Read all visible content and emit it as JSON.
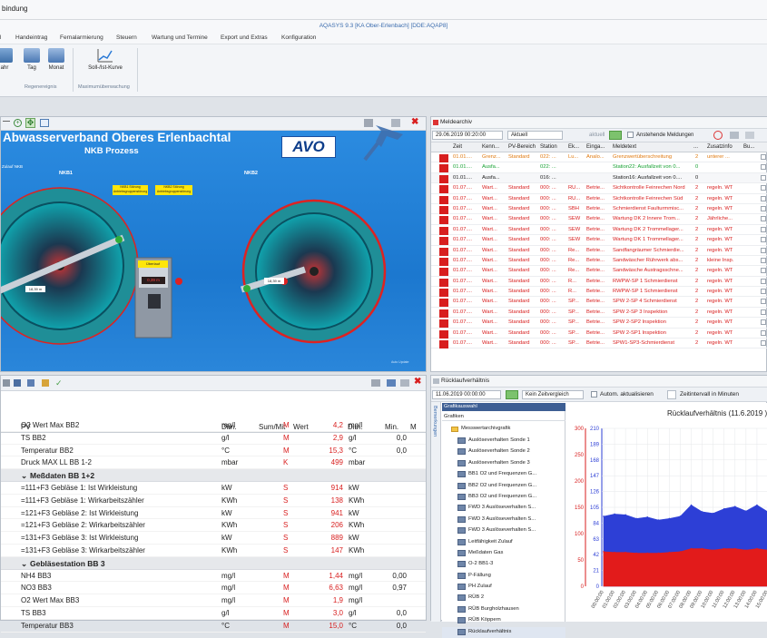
{
  "window_title": "bindung",
  "app_subtitle": "AQASYS 9.3 [KA Ober-Erlenbach] [DDE:AQAP8]",
  "menu": [
    "l",
    "Handeintrag",
    "Fernalarmierung",
    "Steuern",
    "Wartung und Termine",
    "Export und Extras",
    "Konfiguration"
  ],
  "ribbon": {
    "buttons": [
      "ahr",
      "Tag",
      "Monat",
      "Soll-/Ist-Kurve"
    ],
    "groups": [
      "Regenereignis",
      "Maximumüberwachung"
    ]
  },
  "process": {
    "title": "Abwasserverband Oberes Erlenbachtal",
    "subtitle": "NKB Prozess",
    "logo": "AVO",
    "left_label": "NKB1",
    "right_label": "NKB2",
    "left_small_label": "Zulauf NKB",
    "box_warn_1": "NKB1 Störung Antriebsgruppenstörung",
    "box_warn_2": "NKB2 Störung Antriebsgruppenstörung",
    "center_box_label": "Überlauf",
    "center_value": "0,39 m",
    "left_meter": "18,39 m",
    "right_meter": "18,39 m",
    "footer_note": "Auto Update"
  },
  "meldearchiv": {
    "title": "Meldearchiv",
    "datetime": "29.06.2019 00:20:00",
    "mode": "Aktuell",
    "aktuell": "aktuell",
    "pending_label": "Anstehende Meldungen",
    "columns": [
      "Zeit",
      "Kenn...",
      "PV-Bereich",
      "Station",
      "Ek...",
      "Einga...",
      "Meldetext",
      "...",
      "Zusatzinfo",
      "Bu..."
    ],
    "rows": [
      [
        "01.01....",
        "Grenz...",
        "Standard",
        "022: ...",
        "Lu...",
        "Analo...",
        "Grenzwertüberschreitung",
        "2",
        "unterer ...",
        "orange"
      ],
      [
        "01.01....",
        "Ausfa...",
        "",
        "022: ...",
        "",
        "",
        "Station22: Ausfallzeit von 0...",
        "0",
        "",
        "green"
      ],
      [
        "01.01....",
        "Ausfa...",
        "",
        "016: ...",
        "",
        "",
        "Station16: Ausfallzeit von 0....",
        "0",
        "",
        "black"
      ],
      [
        "01.07....",
        "Wart...",
        "Standard",
        "000: ...",
        "RU...",
        "Betrie...",
        "Sichtkontrolle Feinrechen Nord",
        "2",
        "regeln. WT",
        "red"
      ],
      [
        "01.07....",
        "Wart...",
        "Standard",
        "000: ...",
        "RU...",
        "Betrie...",
        "Sichtkontrolle Feinrechen Süd",
        "2",
        "regeln. WT",
        "red"
      ],
      [
        "01.07....",
        "Wart...",
        "Standard",
        "000: ...",
        "SBH",
        "Betrie...",
        "Schmierdienst Faulturmmisc...",
        "2",
        "regeln. WT",
        "red"
      ],
      [
        "01.07....",
        "Wart...",
        "Standard",
        "000: ...",
        "SEW",
        "Betrie...",
        "Wartung DK 2 Innere Trom...",
        "2",
        "Jährliche...",
        "red"
      ],
      [
        "01.07....",
        "Wart...",
        "Standard",
        "000: ...",
        "SEW",
        "Betrie...",
        "Wartung DK 2 Trommellager...",
        "2",
        "regeln. WT",
        "red"
      ],
      [
        "01.07....",
        "Wart...",
        "Standard",
        "000: ...",
        "SEW",
        "Betrie...",
        "Wartung DK 1 Trommellager...",
        "2",
        "regeln. WT",
        "red"
      ],
      [
        "01.07....",
        "Wart...",
        "Standard",
        "000: ...",
        "Re...",
        "Betrie...",
        "Sandfangräumer Schmierdie...",
        "2",
        "regeln. WT",
        "red"
      ],
      [
        "01.07....",
        "Wart...",
        "Standard",
        "000: ...",
        "Re...",
        "Betrie...",
        "Sandwäscher Rührwerk abs...",
        "2",
        "kleine Insp.",
        "red"
      ],
      [
        "01.07....",
        "Wart...",
        "Standard",
        "000: ...",
        "Re...",
        "Betrie...",
        "Sandwäsche Austragsschne...",
        "2",
        "regeln. WT",
        "red"
      ],
      [
        "01.07....",
        "Wart...",
        "Standard",
        "000: ...",
        "R...",
        "Betrie...",
        "RWPW-SP 1 Schmierdienst",
        "2",
        "regeln. WT",
        "red"
      ],
      [
        "01.07....",
        "Wart...",
        "Standard",
        "000: ...",
        "R...",
        "Betrie...",
        "RWPW-SP 1 Schmierdienst",
        "2",
        "regeln. WT",
        "red"
      ],
      [
        "01.07....",
        "Wart...",
        "Standard",
        "000: ...",
        "SP...",
        "Betrie...",
        "SPW 2-SP 4 Schmierdienst",
        "2",
        "regeln. WT",
        "red"
      ],
      [
        "01.07....",
        "Wart...",
        "Standard",
        "000: ...",
        "SP...",
        "Betrie...",
        "SPW 2-SP 3 Inspektion",
        "2",
        "regeln. WT",
        "red"
      ],
      [
        "01.07....",
        "Wart...",
        "Standard",
        "000: ...",
        "SP...",
        "Betrie...",
        "SPW 2-SP2 Inspektion",
        "2",
        "regeln. WT",
        "red"
      ],
      [
        "01.07....",
        "Wart...",
        "Standard",
        "000: ...",
        "SP...",
        "Betrie...",
        "SPW 2-SP1 Inspektion",
        "2",
        "regeln. WT",
        "red"
      ],
      [
        "01.07....",
        "Wart...",
        "Standard",
        "000: ...",
        "SP...",
        "Betrie...",
        "SPW1-SP3-Schmierdienst",
        "2",
        "regeln. WT",
        "red"
      ]
    ]
  },
  "pvtable": {
    "columns": [
      "PV",
      "Dim.",
      "Sum/Mit",
      "Wert",
      "Dim.",
      "Min.",
      "M"
    ],
    "rows": [
      {
        "t": "r",
        "pv": "O2 Wert Max BB2",
        "dim": "mg/l",
        "sum": "M",
        "wert": "4,2",
        "dim2": "mg/l",
        "min": ""
      },
      {
        "t": "r",
        "pv": "TS BB2",
        "dim": "g/l",
        "sum": "M",
        "wert": "2,9",
        "dim2": "g/l",
        "min": "0,0"
      },
      {
        "t": "r",
        "pv": "Temperatur BB2",
        "dim": "°C",
        "sum": "M",
        "wert": "15,3",
        "dim2": "°C",
        "min": "0,0"
      },
      {
        "t": "r",
        "pv": "Druck MAX LL BB 1-2",
        "dim": "mbar",
        "sum": "K",
        "wert": "499",
        "dim2": "mbar",
        "min": ""
      },
      {
        "t": "g",
        "pv": "Meßdaten BB 1+2"
      },
      {
        "t": "r",
        "pv": "=111+F3 Gebläse 1: Ist Wirkleistung",
        "dim": "kW",
        "sum": "S",
        "wert": "914",
        "dim2": "kW",
        "min": ""
      },
      {
        "t": "r",
        "pv": "=111+F3 Gebläse 1: Wirkarbeitszähler",
        "dim": "KWh",
        "sum": "S",
        "wert": "138",
        "dim2": "KWh",
        "min": ""
      },
      {
        "t": "r",
        "pv": "=121+F3 Gebläse 2: Ist Wirkleistung",
        "dim": "kW",
        "sum": "S",
        "wert": "941",
        "dim2": "kW",
        "min": ""
      },
      {
        "t": "r",
        "pv": "=121+F3 Gebläse 2: Wirkarbeitszähler",
        "dim": "KWh",
        "sum": "S",
        "wert": "206",
        "dim2": "KWh",
        "min": ""
      },
      {
        "t": "r",
        "pv": "=131+F3 Gebläse 3: Ist Wirkleistung",
        "dim": "kW",
        "sum": "S",
        "wert": "889",
        "dim2": "kW",
        "min": ""
      },
      {
        "t": "r",
        "pv": "=131+F3 Gebläse 3: Wirkarbeitszähler",
        "dim": "KWh",
        "sum": "S",
        "wert": "147",
        "dim2": "KWh",
        "min": ""
      },
      {
        "t": "g",
        "pv": "Gebläsestation BB 3"
      },
      {
        "t": "r",
        "pv": "NH4 BB3",
        "dim": "mg/l",
        "sum": "M",
        "wert": "1,44",
        "dim2": "mg/l",
        "min": "0,00"
      },
      {
        "t": "r",
        "pv": "NO3 BB3",
        "dim": "mg/l",
        "sum": "M",
        "wert": "6,63",
        "dim2": "mg/l",
        "min": "0,97"
      },
      {
        "t": "r",
        "pv": "O2 Wert Max BB3",
        "dim": "mg/l",
        "sum": "M",
        "wert": "1,9",
        "dim2": "mg/l",
        "min": ""
      },
      {
        "t": "r",
        "pv": "TS BB3",
        "dim": "g/l",
        "sum": "M",
        "wert": "3,0",
        "dim2": "g/l",
        "min": "0,0"
      },
      {
        "t": "r",
        "pv": "Temperatur BB3",
        "dim": "°C",
        "sum": "M",
        "wert": "15,0",
        "dim2": "°C",
        "min": "0,0"
      }
    ]
  },
  "ruecklauf": {
    "title": "Rücklaufverhältnis",
    "datetime": "11.06.2019 00:00:00",
    "range": "Kein Zeitvergleich",
    "auto_label": "Autom. aktualisieren",
    "interval_label": "Zeitintervall in Minuten",
    "side_tab": "Bemerkungen",
    "tree_header": "Grafikauswahl",
    "tree_filter": "Grafiken",
    "tree_root": "Messwertarchivgrafik",
    "tree_items": [
      "Auslöseverhalten Sonde 1",
      "Auslöseverhalten Sonde 2",
      "Auslöseverhalten Sonde 3",
      "BB1 O2 und Frequenzen G...",
      "BB2 O2 und Frequenzen G...",
      "BB3 O2 und Frequenzen G...",
      "FWD 3 Auslöseverhalten S...",
      "FWD 3 Auslöseverhalten S...",
      "FWD 3 Auslöseverhalten S...",
      "Leitfähigkeit Zulauf",
      "Meßdaten Gas",
      "O-2 BB1-3",
      "P-Fällung",
      "PH Zulauf",
      "RÜB 2",
      "RÜB Burgholzhausen",
      "RÜB Köppern",
      "Rücklaufverhältnis"
    ]
  },
  "chart_data": {
    "type": "area",
    "title": "Rücklaufverhältnis (11.6.2019 )",
    "y_left_ticks": [
      0,
      50,
      100,
      150,
      200,
      250,
      300
    ],
    "y_right_ticks": [
      0,
      21,
      42,
      63,
      84,
      105,
      126,
      147,
      168,
      189,
      210
    ],
    "x": [
      "00:00:00",
      "01:00:00",
      "02:00:00",
      "03:00:00",
      "04:00:00",
      "05:00:00",
      "06:00:00",
      "07:00:00",
      "08:00:00",
      "09:00:00",
      "10:00:00",
      "11:00:00",
      "12:00:00",
      "13:00:00",
      "14:00:00",
      "15:00:00"
    ],
    "series": [
      {
        "color": "#2d3fd6",
        "values": [
          93,
          96,
          95,
          90,
          92,
          88,
          90,
          93,
          108,
          99,
          97,
          103,
          106,
          100,
          108,
          99
        ]
      },
      {
        "color": "#e21b1b",
        "values": [
          46,
          45,
          45,
          44,
          44,
          44,
          45,
          46,
          50,
          50,
          48,
          50,
          50,
          48,
          50,
          48
        ]
      }
    ]
  },
  "colors": {
    "accent": "#1a6fc9",
    "hmi_bg": "#1d7fd5",
    "alarm_red": "#d81e1e"
  }
}
